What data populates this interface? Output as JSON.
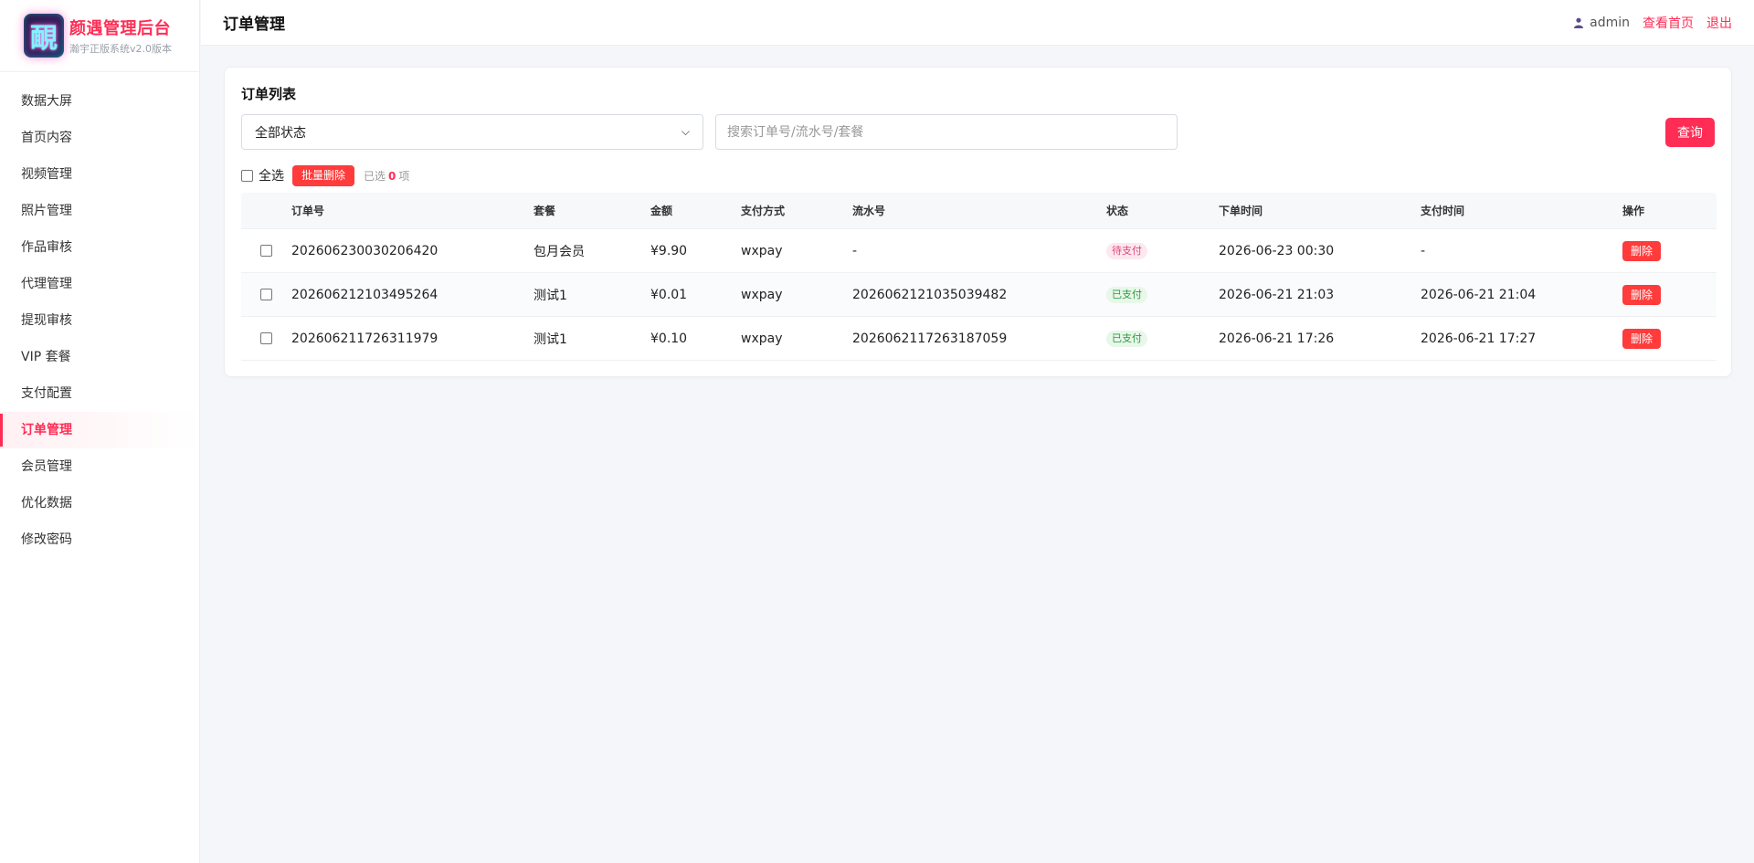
{
  "brand": {
    "logo_char": "靦",
    "title": "颜遇管理后台",
    "subtitle": "瀚宇正版系统v2.0版本"
  },
  "sidebar": {
    "items": [
      {
        "label": "数据大屏"
      },
      {
        "label": "首页内容"
      },
      {
        "label": "视频管理"
      },
      {
        "label": "照片管理"
      },
      {
        "label": "作品审核"
      },
      {
        "label": "代理管理"
      },
      {
        "label": "提现审核"
      },
      {
        "label": "VIP 套餐"
      },
      {
        "label": "支付配置"
      },
      {
        "label": "订单管理",
        "active": true
      },
      {
        "label": "会员管理"
      },
      {
        "label": "优化数据"
      },
      {
        "label": "修改密码"
      }
    ]
  },
  "header": {
    "title": "订单管理",
    "user": "admin",
    "links": [
      "查看首页",
      "退出"
    ]
  },
  "card": {
    "title": "订单列表",
    "filter_value": "全部状态",
    "search_placeholder": "搜索订单号/流水号/套餐",
    "query_label": "查询",
    "select_all_label": "全选",
    "batch_delete_label": "批量删除",
    "selected_prefix": "已选",
    "selected_count": "0",
    "selected_suffix": "项"
  },
  "table": {
    "columns": [
      "订单号",
      "套餐",
      "金额",
      "支付方式",
      "流水号",
      "状态",
      "下单时间",
      "支付时间",
      "操作"
    ],
    "rows": [
      {
        "order": "202606230030206420",
        "plan": "包月会员",
        "amount": "¥9.90",
        "pay": "wxpay",
        "flow": "-",
        "status": "待支付",
        "status_type": "pending",
        "created": "2026-06-23 00:30",
        "paid": "-",
        "op": "删除"
      },
      {
        "order": "202606212103495264",
        "plan": "测试1",
        "amount": "¥0.01",
        "pay": "wxpay",
        "flow": "2026062121035039482",
        "status": "已支付",
        "status_type": "paid",
        "created": "2026-06-21 21:03",
        "paid": "2026-06-21 21:04",
        "op": "删除"
      },
      {
        "order": "202606211726311979",
        "plan": "测试1",
        "amount": "¥0.10",
        "pay": "wxpay",
        "flow": "2026062117263187059",
        "status": "已支付",
        "status_type": "paid",
        "created": "2026-06-21 17:26",
        "paid": "2026-06-21 17:27",
        "op": "删除"
      }
    ]
  },
  "colors": {
    "accent": "#ff2d55",
    "danger": "#ff3b3b",
    "pending_bg": "#fde8ef",
    "paid_bg": "#e7f7e9"
  }
}
